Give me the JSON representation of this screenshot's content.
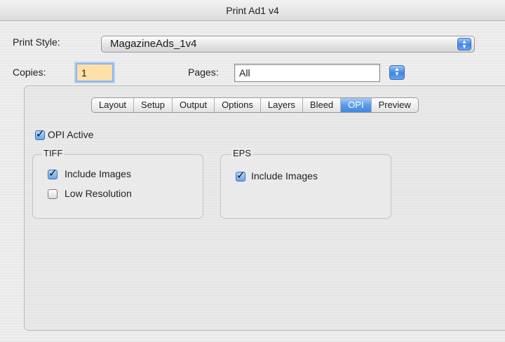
{
  "window": {
    "title": "Print Ad1 v4"
  },
  "print_style": {
    "label": "Print Style:",
    "value": "MagazineAds_1v4"
  },
  "copies": {
    "label": "Copies:",
    "value": "1"
  },
  "pages": {
    "label": "Pages:",
    "value": "All"
  },
  "tabs": [
    {
      "label": "Layout"
    },
    {
      "label": "Setup"
    },
    {
      "label": "Output"
    },
    {
      "label": "Options"
    },
    {
      "label": "Layers"
    },
    {
      "label": "Bleed"
    },
    {
      "label": "OPI",
      "active": true
    },
    {
      "label": "Preview"
    }
  ],
  "opi": {
    "active_label": "OPI Active",
    "active_checked": true,
    "tiff": {
      "title": "TIFF",
      "include_images_label": "Include Images",
      "include_images_checked": true,
      "low_res_label": "Low Resolution",
      "low_res_checked": false
    },
    "eps": {
      "title": "EPS",
      "include_images_label": "Include Images",
      "include_images_checked": true
    }
  },
  "colors": {
    "accent": "#3f88e2",
    "focus_fill": "#ffe0a8"
  }
}
